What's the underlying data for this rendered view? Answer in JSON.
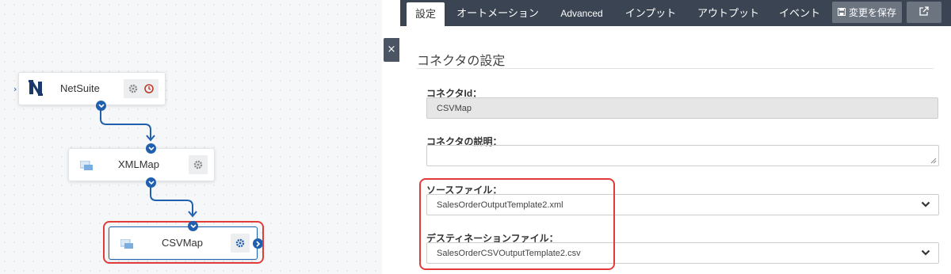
{
  "canvas": {
    "nodes": [
      {
        "label": "NetSuite"
      },
      {
        "label": "XMLMap"
      },
      {
        "label": "CSVMap"
      }
    ]
  },
  "toggle": {
    "icon": "close-icon",
    "glyph": "×"
  },
  "tabs": [
    {
      "label": "設定",
      "active": true
    },
    {
      "label": "オートメーション"
    },
    {
      "label": "Advanced"
    },
    {
      "label": "インプット"
    },
    {
      "label": "アウトプット"
    },
    {
      "label": "イベント"
    }
  ],
  "toolbar": {
    "save_label": "変更を保存",
    "save_icon": "save-icon",
    "external_icon": "external-link-icon"
  },
  "panel": {
    "section_title": "コネクタの設定",
    "fields": {
      "connector_id_label": "コネクタId：",
      "connector_id_value": "CSVMap",
      "description_label": "コネクタの説明：",
      "description_value": "",
      "source_label": "ソースファイル：",
      "source_value": "SalesOrderOutputTemplate2.xml",
      "dest_label": "デスティネーションファイル：",
      "dest_value": "SalesOrderCSVOutputTemplate2.csv"
    }
  },
  "colors": {
    "accent": "#1f5fad",
    "tabbar": "#3b4453",
    "highlight": "#e23b3b",
    "error": "#c0392b"
  }
}
